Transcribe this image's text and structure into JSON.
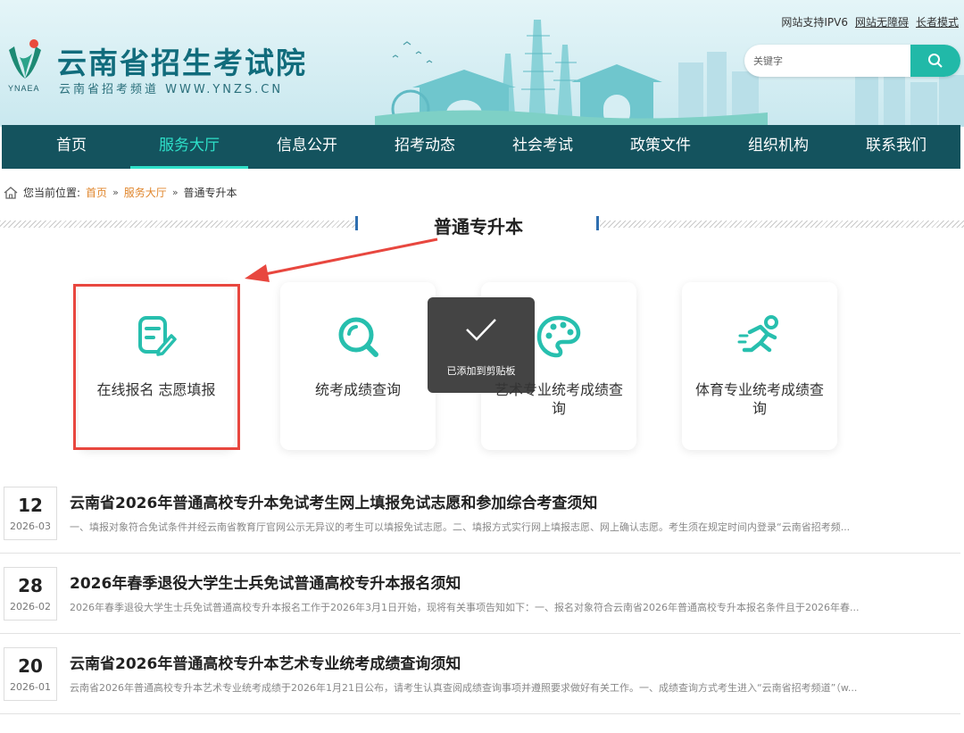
{
  "header": {
    "logo_abbr": "YNAEA",
    "site_title": "云南省招生考试院",
    "site_subtitle": "云南省招考频道 WWW.YNZS.CN",
    "top_links": [
      "网站支持IPV6",
      "网站无障碍",
      "长者模式"
    ],
    "search_placeholder": "关键字"
  },
  "nav": {
    "items": [
      "首页",
      "服务大厅",
      "信息公开",
      "招考动态",
      "社会考试",
      "政策文件",
      "组织机构",
      "联系我们"
    ],
    "active_index": 1
  },
  "breadcrumb": {
    "prefix": "您当前位置:",
    "items": [
      "首页",
      "服务大厅",
      "普通专升本"
    ],
    "separator": "»"
  },
  "section_title": "普通专升本",
  "cards": [
    {
      "label": "在线报名 志愿填报",
      "icon": "form-edit-icon"
    },
    {
      "label": "统考成绩查询",
      "icon": "search-magnifier-icon"
    },
    {
      "label": "艺术专业统考成绩查询",
      "icon": "palette-icon"
    },
    {
      "label": "体育专业统考成绩查询",
      "icon": "runner-icon"
    }
  ],
  "toast": {
    "message": "已添加到剪贴板",
    "icon": "checkmark-icon"
  },
  "news": [
    {
      "day": "12",
      "year_month": "2026-03",
      "title": "云南省2026年普通高校专升本免试考生网上填报免试志愿和参加综合考查须知",
      "desc": "一、填报对象符合免试条件并经云南省教育厅官网公示无异议的考生可以填报免试志愿。二、填报方式实行网上填报志愿、网上确认志愿。考生须在规定时间内登录“云南省招考频..."
    },
    {
      "day": "28",
      "year_month": "2026-02",
      "title": "2026年春季退役大学生士兵免试普通高校专升本报名须知",
      "desc": "2026年春季退役大学生士兵免试普通高校专升本报名工作于2026年3月1日开始，现将有关事项告知如下：一、报名对象符合云南省2026年普通高校专升本报名条件且于2026年春..."
    },
    {
      "day": "20",
      "year_month": "2026-01",
      "title": "云南省2026年普通高校专升本艺术专业统考成绩查询须知",
      "desc": "云南省2026年普通高校专升本艺术专业统考成绩于2026年1月21日公布，请考生认真查阅成绩查询事项并遵照要求做好有关工作。一、成绩查询方式考生进入“云南省招考频道”（w..."
    }
  ],
  "colors": {
    "nav_bg": "#14535e",
    "nav_active": "#2ee0c9",
    "accent_teal": "#21b9a8",
    "breadcrumb_link": "#e0862c",
    "highlight_red": "#e8473f"
  }
}
